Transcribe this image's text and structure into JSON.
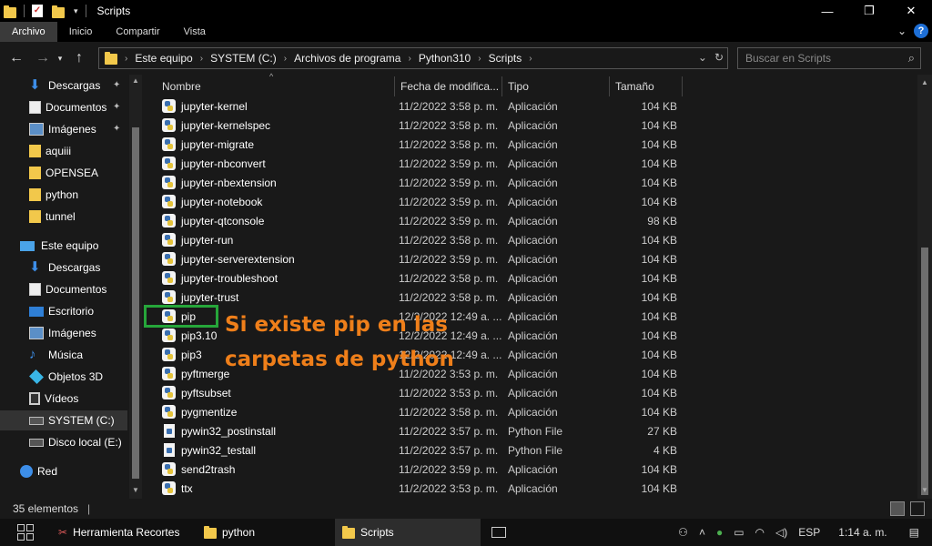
{
  "window": {
    "title": "Scripts",
    "minimize": "—",
    "maximize": "❐",
    "close": "✕"
  },
  "ribbon": {
    "tabs": [
      "Archivo",
      "Inicio",
      "Compartir",
      "Vista"
    ],
    "expand": "⌄",
    "help": "?"
  },
  "address": {
    "crumbs": [
      "Este equipo",
      "SYSTEM (C:)",
      "Archivos de programa",
      "Python310",
      "Scripts"
    ],
    "search_placeholder": "Buscar en Scripts"
  },
  "nav": {
    "quick": [
      {
        "label": "Descargas",
        "icon": "download-icon",
        "pinned": true
      },
      {
        "label": "Documentos",
        "icon": "documents-icon",
        "pinned": true
      },
      {
        "label": "Imágenes",
        "icon": "pictures-icon",
        "pinned": true
      },
      {
        "label": "aquiii",
        "icon": "folder-icon",
        "pinned": false
      },
      {
        "label": "OPENSEA",
        "icon": "folder-icon",
        "pinned": false
      },
      {
        "label": "python",
        "icon": "folder-icon",
        "pinned": false
      },
      {
        "label": "tunnel",
        "icon": "folder-icon",
        "pinned": false
      }
    ],
    "this_pc": "Este equipo",
    "pc_items": [
      {
        "label": "Descargas",
        "icon": "download-icon"
      },
      {
        "label": "Documentos",
        "icon": "documents-icon"
      },
      {
        "label": "Escritorio",
        "icon": "desktop-icon"
      },
      {
        "label": "Imágenes",
        "icon": "pictures-icon"
      },
      {
        "label": "Música",
        "icon": "music-icon"
      },
      {
        "label": "Objetos 3D",
        "icon": "objects-3d-icon"
      },
      {
        "label": "Vídeos",
        "icon": "videos-icon"
      },
      {
        "label": "SYSTEM (C:)",
        "icon": "drive-icon",
        "selected": true
      },
      {
        "label": "Disco local (E:)",
        "icon": "drive-icon"
      }
    ],
    "network": "Red"
  },
  "columns": [
    "Nombre",
    "Fecha de modifica...",
    "Tipo",
    "Tamaño"
  ],
  "files": [
    {
      "name": "jupyter-kernel",
      "date": "11/2/2022 3:58 p. m.",
      "type": "Aplicación",
      "size": "104 KB",
      "icon": "python-app"
    },
    {
      "name": "jupyter-kernelspec",
      "date": "11/2/2022 3:58 p. m.",
      "type": "Aplicación",
      "size": "104 KB",
      "icon": "python-app"
    },
    {
      "name": "jupyter-migrate",
      "date": "11/2/2022 3:58 p. m.",
      "type": "Aplicación",
      "size": "104 KB",
      "icon": "python-app"
    },
    {
      "name": "jupyter-nbconvert",
      "date": "11/2/2022 3:59 p. m.",
      "type": "Aplicación",
      "size": "104 KB",
      "icon": "python-app"
    },
    {
      "name": "jupyter-nbextension",
      "date": "11/2/2022 3:59 p. m.",
      "type": "Aplicación",
      "size": "104 KB",
      "icon": "python-app"
    },
    {
      "name": "jupyter-notebook",
      "date": "11/2/2022 3:59 p. m.",
      "type": "Aplicación",
      "size": "104 KB",
      "icon": "python-app"
    },
    {
      "name": "jupyter-qtconsole",
      "date": "11/2/2022 3:59 p. m.",
      "type": "Aplicación",
      "size": "98 KB",
      "icon": "python-app"
    },
    {
      "name": "jupyter-run",
      "date": "11/2/2022 3:58 p. m.",
      "type": "Aplicación",
      "size": "104 KB",
      "icon": "python-app"
    },
    {
      "name": "jupyter-serverextension",
      "date": "11/2/2022 3:59 p. m.",
      "type": "Aplicación",
      "size": "104 KB",
      "icon": "python-app"
    },
    {
      "name": "jupyter-troubleshoot",
      "date": "11/2/2022 3:58 p. m.",
      "type": "Aplicación",
      "size": "104 KB",
      "icon": "python-app"
    },
    {
      "name": "jupyter-trust",
      "date": "11/2/2022 3:58 p. m.",
      "type": "Aplicación",
      "size": "104 KB",
      "icon": "python-app"
    },
    {
      "name": "pip",
      "date": "12/2/2022 12:49 a. ...",
      "type": "Aplicación",
      "size": "104 KB",
      "icon": "python-app"
    },
    {
      "name": "pip3.10",
      "date": "12/2/2022 12:49 a. ...",
      "type": "Aplicación",
      "size": "104 KB",
      "icon": "python-app"
    },
    {
      "name": "pip3",
      "date": "12/2/2022 12:49 a. ...",
      "type": "Aplicación",
      "size": "104 KB",
      "icon": "python-app"
    },
    {
      "name": "pyftmerge",
      "date": "11/2/2022 3:53 p. m.",
      "type": "Aplicación",
      "size": "104 KB",
      "icon": "python-app"
    },
    {
      "name": "pyftsubset",
      "date": "11/2/2022 3:53 p. m.",
      "type": "Aplicación",
      "size": "104 KB",
      "icon": "python-app"
    },
    {
      "name": "pygmentize",
      "date": "11/2/2022 3:58 p. m.",
      "type": "Aplicación",
      "size": "104 KB",
      "icon": "python-app"
    },
    {
      "name": "pywin32_postinstall",
      "date": "11/2/2022 3:57 p. m.",
      "type": "Python File",
      "size": "27 KB",
      "icon": "python-file"
    },
    {
      "name": "pywin32_testall",
      "date": "11/2/2022 3:57 p. m.",
      "type": "Python File",
      "size": "4 KB",
      "icon": "python-file"
    },
    {
      "name": "send2trash",
      "date": "11/2/2022 3:59 p. m.",
      "type": "Aplicación",
      "size": "104 KB",
      "icon": "python-app"
    },
    {
      "name": "ttx",
      "date": "11/2/2022 3:53 p. m.",
      "type": "Aplicación",
      "size": "104 KB",
      "icon": "python-app"
    }
  ],
  "annotation": {
    "line1": "Si existe pip en las",
    "line2": "carpetas de python",
    "color": "#ef7f1a",
    "box_color": "#26a63a"
  },
  "status": {
    "count": "35 elementos"
  },
  "taskbar": {
    "items": [
      {
        "label": "Herramienta Recortes",
        "icon": "snipping-tool-icon",
        "active": false
      },
      {
        "label": "python",
        "icon": "folder-icon",
        "active": false
      },
      {
        "label": "Scripts",
        "icon": "folder-icon",
        "active": true
      }
    ],
    "language": "ESP",
    "time": "1:14 a. m."
  }
}
